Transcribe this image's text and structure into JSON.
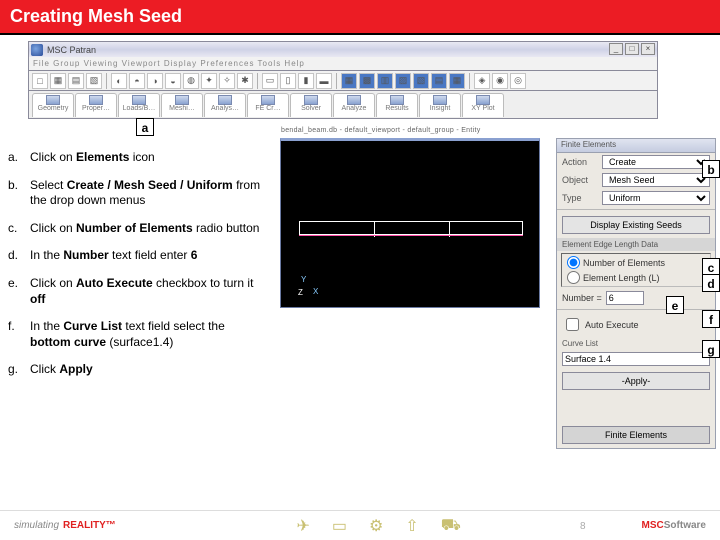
{
  "slide": {
    "title": "Creating Mesh Seed",
    "page_number": "8"
  },
  "app_window": {
    "title": "MSC Patran",
    "menubar": "File  Group  Viewing  Viewport  Display  Preferences  Tools  Help",
    "tabs": [
      "Geometry",
      "Proper…",
      "Loads/B…",
      "Meshi…",
      "Analys…",
      "FE Cr…",
      "Solver",
      "Analyze",
      "Results",
      "Insight",
      "XY Plot"
    ],
    "window_buttons": {
      "min": "_",
      "max": "□",
      "close": "×"
    }
  },
  "viewport": {
    "caption": "bendal_beam.db - default_viewport - default_group - Entity"
  },
  "callouts": {
    "a": "a",
    "b": "b",
    "c": "c",
    "d": "d",
    "e": "e",
    "f": "f",
    "g": "g"
  },
  "steps": {
    "a": {
      "label": "a.",
      "pre": "Click on ",
      "bold": "Elements",
      "post": " icon"
    },
    "b": {
      "label": "b.",
      "pre": "Select ",
      "bold": "Create / Mesh Seed / Uniform",
      "post": " from the drop down menus"
    },
    "c": {
      "label": "c.",
      "pre": "Click on ",
      "bold": "Number of Elements",
      "post": " radio button"
    },
    "d": {
      "label": "d.",
      "pre": "In the ",
      "bold": "Number",
      "post1": " text field enter ",
      "bold2": "6"
    },
    "e": {
      "label": "e.",
      "pre": "Click on ",
      "bold": "Auto Execute",
      "post": " checkbox to turn it ",
      "bold2": "off"
    },
    "f": {
      "label": "f.",
      "pre": "In the ",
      "bold": "Curve List",
      "post1": " text field select the ",
      "bold2": "bottom curve",
      "post2": " (surface1.4)"
    },
    "g": {
      "label": "g.",
      "pre": "Click ",
      "bold": "Apply"
    }
  },
  "panel": {
    "title": "Finite Elements",
    "action_label": "Action",
    "object_label": "Object",
    "type_label": "Type",
    "action": "Create",
    "object": "Mesh Seed",
    "type": "Uniform",
    "section1": "Display Existing Seeds",
    "section2": "Element Edge Length Data",
    "radio_num": "Number of Elements",
    "radio_len": "Element Length (L)",
    "number_label": "Number =",
    "number_value": "6",
    "auto_exec": "Auto Execute",
    "curve_list_label": "Curve List",
    "curve_list": "Surface 1.4",
    "apply": "-Apply-",
    "footer_btn": "Finite Elements"
  },
  "footer": {
    "brand_left_1": "simulating",
    "brand_left_2": "REALITY™",
    "brand_right_1": "MSC",
    "brand_right_2": "Software"
  }
}
